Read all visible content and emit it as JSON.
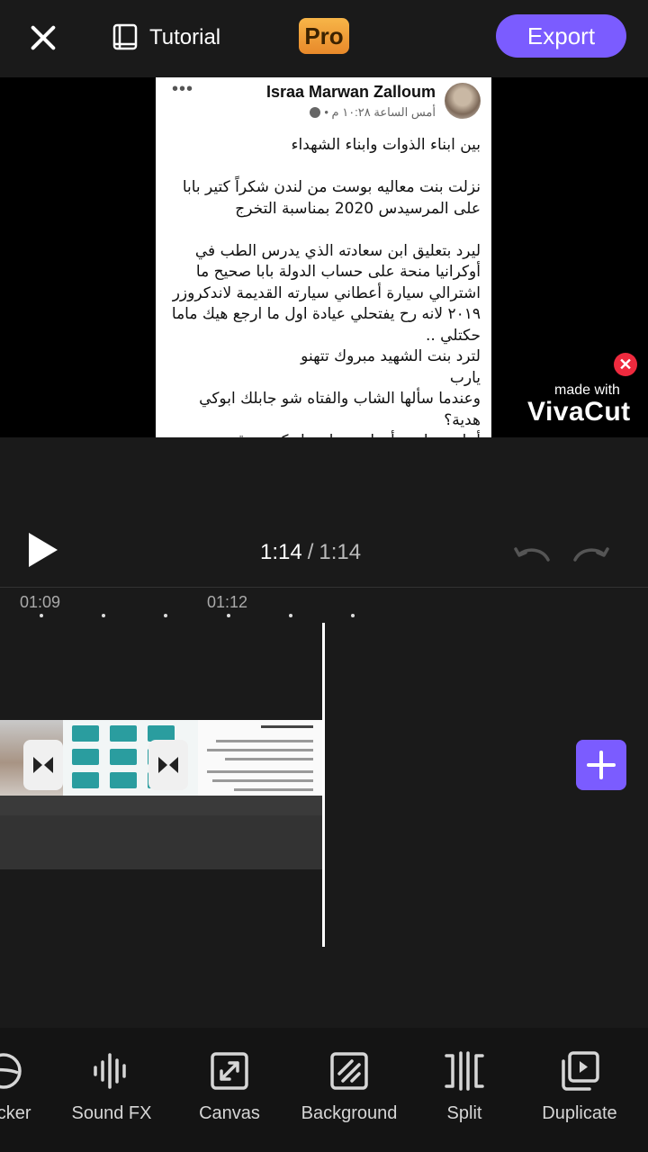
{
  "topbar": {
    "tutorial_label": "Tutorial",
    "pro_label": "Pro",
    "export_label": "Export"
  },
  "post": {
    "author": "Israa Marwan Zalloum",
    "time": "أمس الساعة ١٠:٢٨ م •",
    "menu": "•••",
    "paragraphs": [
      "بين ابناء الذوات وابناء الشهداء",
      "نزلت بنت معاليه بوست من لندن شكراً كتير بابا على المرسيدس 2020 بمناسبة التخرج",
      "ليرد بتعليق ابن سعادته الذي يدرس الطب في أوكرانيا منحة على حساب الدولة بابا صحيح ما اشترالي سيارة أعطاني سيارته القديمة لاندكروزر ٢٠١٩ لانه رح يفتحلي عيادة اول ما ارجع هيك ماما حكتلي ..\nلترد بنت الشهيد مبروك تتهنو\nيارب\nوعندما سألها الشاب والفتاه شو جابلك ابوكي هدية؟\nأجابت : ابوي أهداني وطن وابوكم سرقه ."
    ]
  },
  "watermark": {
    "made_with": "made with",
    "brand": "VivaCut",
    "close": "✕"
  },
  "playback": {
    "current": "1:14",
    "separator": "/",
    "total": "1:14"
  },
  "timeline": {
    "ticks": [
      "01:09",
      "01:12"
    ]
  },
  "tools": [
    {
      "icon": "sticker-icon",
      "label": "Sticker"
    },
    {
      "icon": "sound-fx-icon",
      "label": "Sound FX"
    },
    {
      "icon": "canvas-icon",
      "label": "Canvas"
    },
    {
      "icon": "background-icon",
      "label": "Background"
    },
    {
      "icon": "split-icon",
      "label": "Split"
    },
    {
      "icon": "duplicate-icon",
      "label": "Duplicate"
    }
  ],
  "colors": {
    "accent": "#7b5cff",
    "pro_badge": "#f0a03a",
    "background": "#1a1a1a",
    "watermark_close": "#ef2a3e"
  }
}
